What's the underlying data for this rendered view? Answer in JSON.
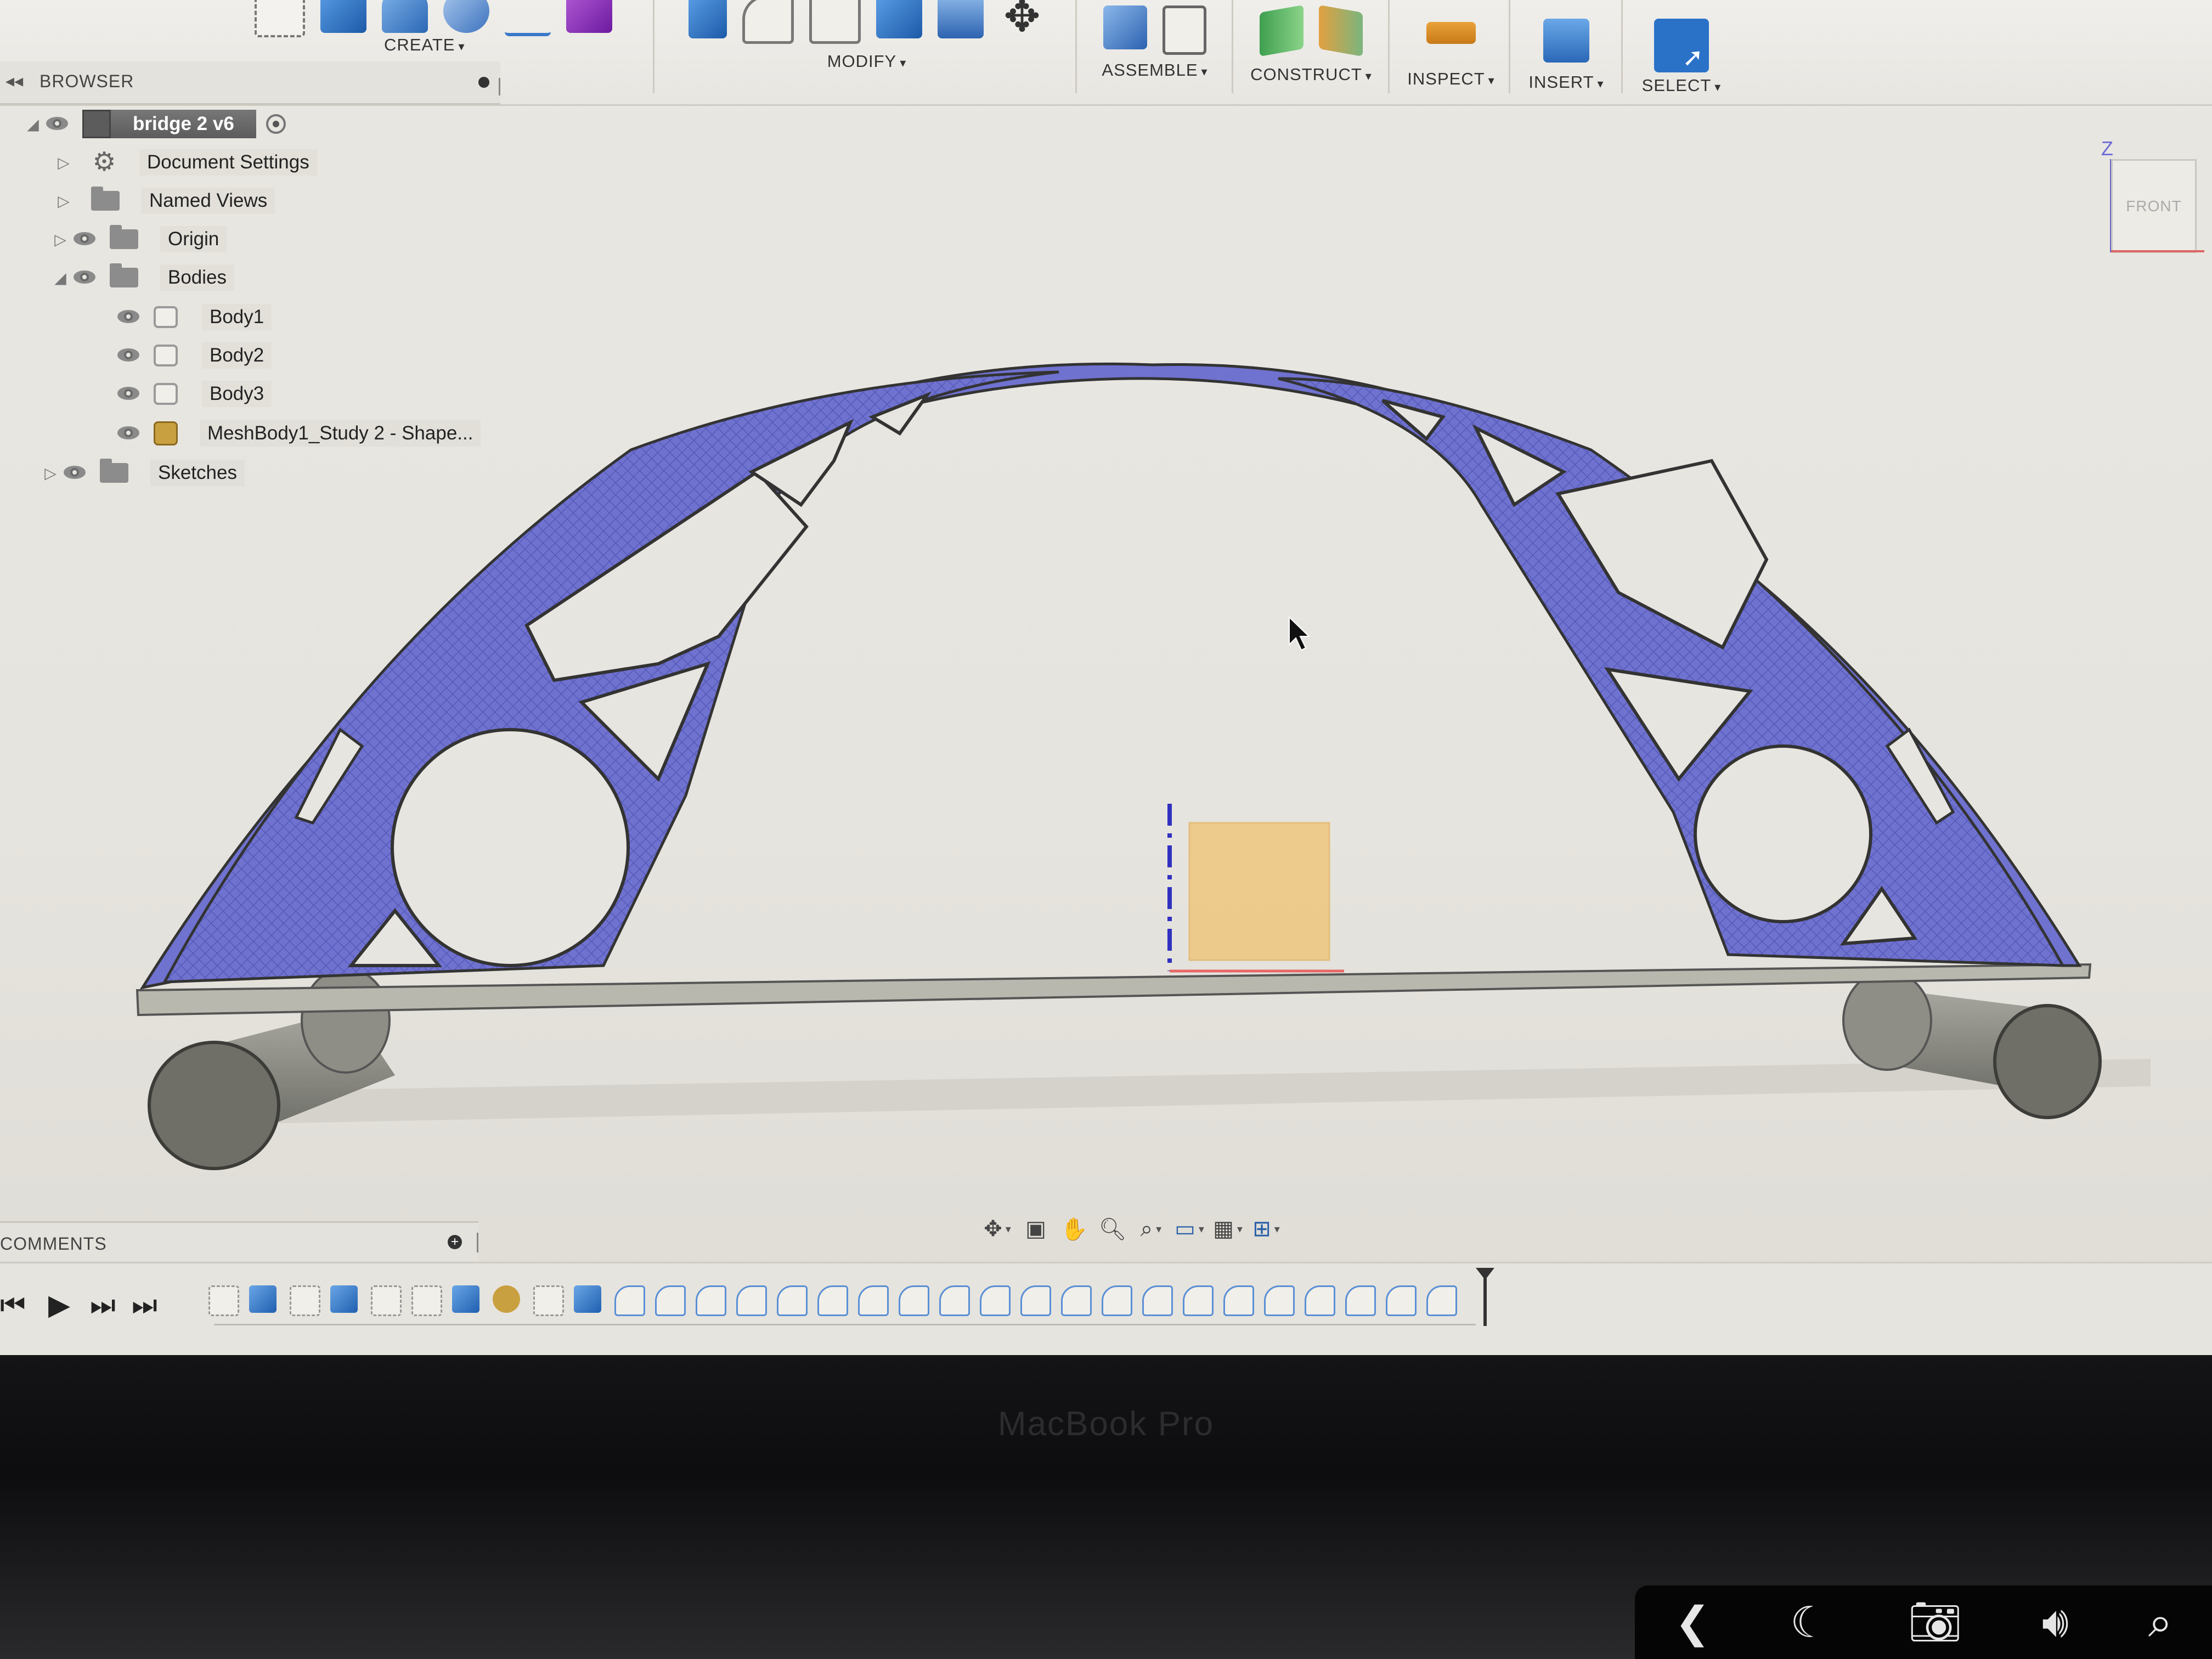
{
  "toolbar": {
    "groups": [
      {
        "label": "CREATE"
      },
      {
        "label": "MODIFY"
      },
      {
        "label": "ASSEMBLE"
      },
      {
        "label": "CONSTRUCT"
      },
      {
        "label": "INSPECT"
      },
      {
        "label": "INSERT"
      },
      {
        "label": "SELECT"
      }
    ]
  },
  "browser": {
    "title": "BROWSER",
    "root": "bridge 2 v6",
    "items": [
      {
        "label": "Document Settings"
      },
      {
        "label": "Named Views"
      },
      {
        "label": "Origin"
      },
      {
        "label": "Bodies"
      },
      {
        "label": "Body1"
      },
      {
        "label": "Body2"
      },
      {
        "label": "Body3"
      },
      {
        "label": "MeshBody1_Study 2 - Shape..."
      },
      {
        "label": "Sketches"
      }
    ]
  },
  "viewcube": {
    "axis": "Z",
    "face": "FRONT"
  },
  "comments": {
    "title": "COMMENTS"
  },
  "laptop": {
    "brand": "MacBook Pro"
  },
  "colors": {
    "mesh": "#6f72cf",
    "accent": "#2a72c8",
    "load_box": "#f4b84a"
  }
}
